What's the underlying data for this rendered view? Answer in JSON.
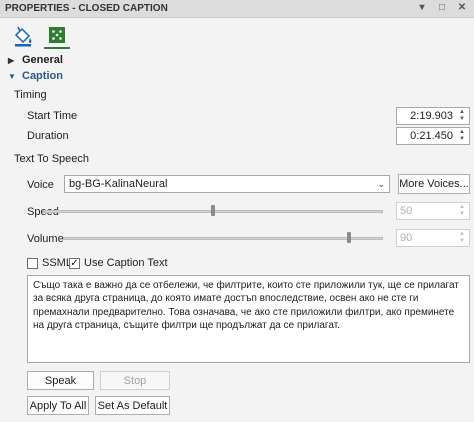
{
  "window": {
    "title": "PROPERTIES - CLOSED CAPTION",
    "controls": [
      "▾",
      "□",
      "✕"
    ]
  },
  "toolbar": {
    "icons": [
      "paint-bucket-icon",
      "caption-properties-icon"
    ],
    "accent": "#2e7d32"
  },
  "sections": {
    "general": "General",
    "caption": "Caption"
  },
  "timing": {
    "heading": "Timing",
    "start_label": "Start Time",
    "start_value": "2:19.903",
    "duration_label": "Duration",
    "duration_value": "0:21.450"
  },
  "tts": {
    "heading": "Text To Speech",
    "voice_label": "Voice",
    "voice_value": "bg-BG-KalinaNeural",
    "more_voices": "More Voices...",
    "speed_label": "Speed",
    "speed_value": "50",
    "speed_level": 0.5,
    "volume_label": "Volume",
    "volume_value": "90",
    "volume_level": 0.9,
    "ssml_label": "SSML",
    "ssml_checked": false,
    "use_caption_label": "Use Caption Text",
    "use_caption_checked": true,
    "text": "Също така е важно да се отбележи, че филтрите, които сте приложили тук, ще се прилагат за всяка друга страница, до която имате достъп впоследствие, освен ако не сте ги премахнали предварително.  Това означава, че ако сте приложили филтри, ако преминете на друга страница, същите филтри ще продължат да се прилагат."
  },
  "buttons": {
    "speak": "Speak",
    "stop": "Stop",
    "apply_to_all": "Apply To All",
    "set_as_default": "Set As Default"
  }
}
